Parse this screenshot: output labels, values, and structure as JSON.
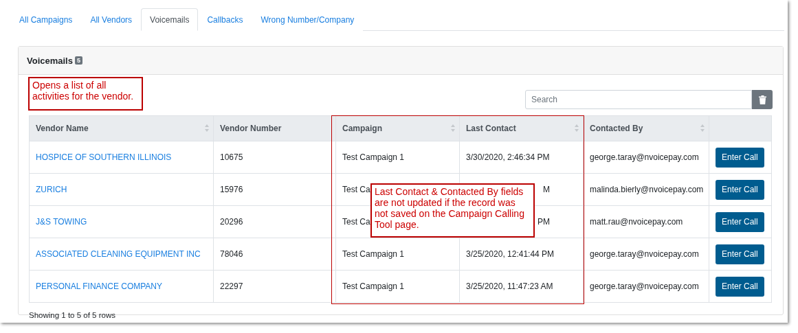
{
  "tabs": [
    {
      "label": "All Campaigns",
      "selected": false
    },
    {
      "label": "All Vendors",
      "selected": false
    },
    {
      "label": "Voicemails",
      "selected": true
    },
    {
      "label": "Callbacks",
      "selected": false
    },
    {
      "label": "Wrong Number/Company",
      "selected": false
    }
  ],
  "panel": {
    "title": "Voicemails",
    "count": "5"
  },
  "search": {
    "placeholder": "Search"
  },
  "table": {
    "columns": [
      {
        "label": "Vendor Name",
        "sortable": true
      },
      {
        "label": "Vendor Number",
        "sortable": false
      },
      {
        "label": "Campaign",
        "sortable": true
      },
      {
        "label": "Last Contact",
        "sortable": true
      },
      {
        "label": "Contacted By",
        "sortable": true
      }
    ],
    "rows": [
      {
        "vendor_name": "HOSPICE OF SOUTHERN ILLINOIS",
        "vendor_number": "10675",
        "campaign": "Test Campaign 1",
        "last_contact": "3/30/2020, 2:46:34 PM",
        "covered": false,
        "contacted_by": "george.taray@nvoicepay.com",
        "action": "Enter Call"
      },
      {
        "vendor_name": "ZURICH",
        "vendor_number": "15976",
        "campaign": "Test Ca",
        "last_contact": "M",
        "covered": true,
        "contacted_by": "malinda.bierly@nvoicepay.com",
        "action": "Enter Call"
      },
      {
        "vendor_name": "J&S TOWING",
        "vendor_number": "20296",
        "campaign": "Test Ca",
        "last_contact": "PM",
        "covered": true,
        "contacted_by": "matt.rau@nvoicepay.com",
        "action": "Enter Call"
      },
      {
        "vendor_name": "ASSOCIATED CLEANING EQUIPMENT INC",
        "vendor_number": "78046",
        "campaign": "Test Campaign 1",
        "last_contact": "3/25/2020, 12:41:44 PM",
        "covered": false,
        "contacted_by": "george.taray@nvoicepay.com",
        "action": "Enter Call"
      },
      {
        "vendor_name": "PERSONAL FINANCE COMPANY",
        "vendor_number": "22297",
        "campaign": "Test Campaign 1",
        "last_contact": "3/25/2020, 11:47:23 AM",
        "covered": false,
        "contacted_by": "george.taray@nvoicepay.com",
        "action": "Enter Call"
      }
    ]
  },
  "footer": "Showing 1 to 5 of 5 rows",
  "callouts": [
    "Opens a list of all activities for the vendor.",
    "Last Contact & Contacted By fields are not updated if the record was not saved on the Campaign Calling Tool page."
  ]
}
